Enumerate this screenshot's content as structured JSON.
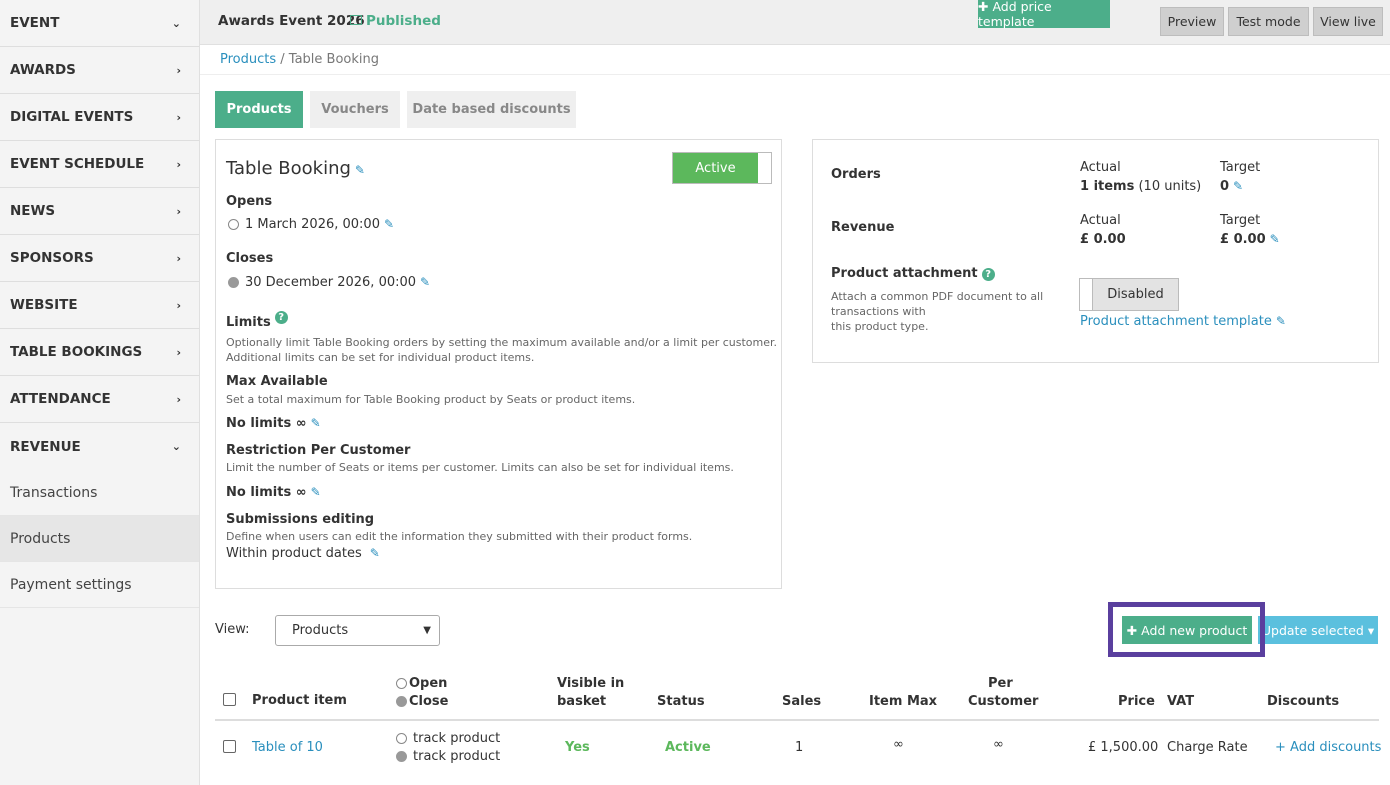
{
  "sidebar": {
    "items": [
      {
        "label": "EVENT",
        "chevron": "⌄"
      },
      {
        "label": "AWARDS",
        "chevron": "›"
      },
      {
        "label": "DIGITAL EVENTS",
        "chevron": "›"
      },
      {
        "label": "EVENT SCHEDULE",
        "chevron": "›"
      },
      {
        "label": "NEWS",
        "chevron": "›"
      },
      {
        "label": "SPONSORS",
        "chevron": "›"
      },
      {
        "label": "WEBSITE",
        "chevron": "›"
      },
      {
        "label": "TABLE BOOKINGS",
        "chevron": "›"
      },
      {
        "label": "ATTENDANCE",
        "chevron": "›"
      },
      {
        "label": "REVENUE",
        "chevron": "⌄"
      }
    ],
    "sub_items": [
      {
        "label": "Transactions"
      },
      {
        "label": "Products"
      },
      {
        "label": "Payment settings"
      }
    ]
  },
  "topbar": {
    "title": "Awards Event 2026",
    "status": "Published",
    "buttons": {
      "preview": "Preview",
      "test_mode": "Test mode",
      "view_live": "View live"
    }
  },
  "breadcrumb": {
    "link": "Products",
    "separator": " / ",
    "current": "Table Booking"
  },
  "tabs": {
    "products": "Products",
    "vouchers": "Vouchers",
    "date_discounts": "Date based discounts"
  },
  "product": {
    "name": "Table Booking",
    "active_label": "Active",
    "opens_label": "Opens",
    "opens_value": "1 March 2026, 00:00",
    "closes_label": "Closes",
    "closes_value": "30 December 2026, 00:00",
    "limits_label": "Limits",
    "limits_desc_1": "Optionally limit Table Booking orders by setting the maximum available and/or a limit per customer.",
    "limits_desc_2": "Additional limits can be set for individual product items.",
    "max_label": "Max Available",
    "max_desc": "Set a total maximum for Table Booking product by Seats or product items.",
    "max_value": "No limits ∞",
    "restriction_label": "Restriction Per Customer",
    "restriction_desc": "Limit the number of Seats or items per customer. Limits can also be set for individual items.",
    "restriction_value": "No limits ∞",
    "submissions_label": "Submissions editing",
    "submissions_desc": "Define when users can edit the information they submitted with their product forms.",
    "submissions_value": "Within product dates"
  },
  "stats": {
    "orders_label": "Orders",
    "actual_label": "Actual",
    "target_label": "Target",
    "orders_actual_bold": "1 items",
    "orders_actual_rest": " (10 units)",
    "orders_target": "0",
    "revenue_label": "Revenue",
    "revenue_actual": "£ 0.00",
    "revenue_target": "£ 0.00",
    "attachment_label": "Product attachment",
    "attachment_desc_1": "Attach a common PDF document to all",
    "attachment_desc_2": "transactions with",
    "attachment_desc_3": "this product type.",
    "disabled_label": "Disabled",
    "template_link": "Product attachment template"
  },
  "view": {
    "label": "View:",
    "selected": "Products"
  },
  "actions": {
    "add_price_template": "✚ Add price template",
    "add_new_product": "✚ Add new product",
    "update_selected": "Update selected ▾"
  },
  "table": {
    "headers": {
      "product_item": "Product item",
      "open": "Open",
      "close": "Close",
      "visible_1": "Visible in",
      "visible_2": "basket",
      "status": "Status",
      "sales": "Sales",
      "item_max": "Item Max",
      "per_1": "Per",
      "per_2": "Customer",
      "price": "Price",
      "vat": "VAT",
      "discounts": "Discounts"
    },
    "rows": [
      {
        "name": "Table of 10",
        "open": "track product",
        "close": "track product",
        "visible": "Yes",
        "status": "Active",
        "sales": "1",
        "item_max": "∞",
        "per_customer": "∞",
        "price": "£ 1,500.00",
        "vat": "Charge Rate",
        "discounts": "+ Add discounts"
      }
    ]
  },
  "colors": {
    "accent": "#4cae8a",
    "link": "#2a8fbd",
    "highlight": "#5a3f9e",
    "info": "#5bc0de"
  }
}
